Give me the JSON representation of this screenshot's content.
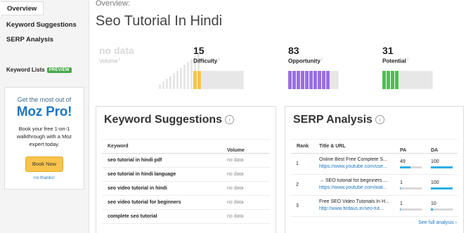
{
  "sidebar": {
    "items": [
      {
        "label": "Overview",
        "active": true
      },
      {
        "label": "Keyword Suggestions"
      },
      {
        "label": "SERP Analysis"
      }
    ],
    "keyword_lists": {
      "label": "Keyword Lists",
      "badge": "PREVIEW"
    },
    "promo": {
      "tagline": "Get the most out of",
      "brand": "Moz Pro!",
      "body": "Book your free 1-on-1 walkthrough with a Moz expert today.",
      "button": "Book Now",
      "dismiss": "no thanks!"
    }
  },
  "header": {
    "crumb": "Overview:",
    "title": "Seo Tutorial In Hindi"
  },
  "metrics": {
    "volume": {
      "value": "no data",
      "label": "Volume"
    },
    "difficulty": {
      "value": "15",
      "label": "Difficulty",
      "color": "#f6c444",
      "filled_segments": 2,
      "total_segments": 12
    },
    "opportunity": {
      "value": "83",
      "label": "Opportunity",
      "color": "#9b6fe0",
      "filled_segments": 10,
      "total_segments": 12
    },
    "potential": {
      "value": "31",
      "label": "Potential",
      "color": "#4cc04c",
      "filled_segments": 4,
      "total_segments": 12
    }
  },
  "keyword_suggestions": {
    "title": "Keyword Suggestions",
    "columns": [
      "Keyword",
      "Volume"
    ],
    "rows": [
      {
        "keyword": "seo tutorial in hindi pdf",
        "volume": "no data"
      },
      {
        "keyword": "seo tutorial in hindi language",
        "volume": "no data"
      },
      {
        "keyword": "seo video tutorial in hindi",
        "volume": "no data"
      },
      {
        "keyword": "seo video tutorial for beginners",
        "volume": "no data"
      },
      {
        "keyword": "complete seo tutorial",
        "volume": "no data"
      }
    ]
  },
  "serp_analysis": {
    "title": "SERP Analysis",
    "columns": [
      "Rank",
      "Title & URL",
      "PA",
      "DA"
    ],
    "rows": [
      {
        "rank": "1",
        "title": "Online Best Free Complete S...",
        "url": "https://www.youtube.com/use...",
        "pa": "49",
        "da": "100"
      },
      {
        "rank": "2",
        "title": "→ SEO tutorial for beginners ...",
        "url": "https://www.youtube.com/wat...",
        "pa": "1",
        "da": "100"
      },
      {
        "rank": "3",
        "title": "Free SEO Video Tutorials In H...",
        "url": "http://www.firdaus.in/seo-tut...",
        "pa": "1",
        "da": "10"
      }
    ],
    "footer_link": "See full analysis"
  },
  "colors": {
    "accent": "#1d77c4",
    "cta": "#f8c44b",
    "badge": "#49a949",
    "minibar": "#2dafe6"
  }
}
